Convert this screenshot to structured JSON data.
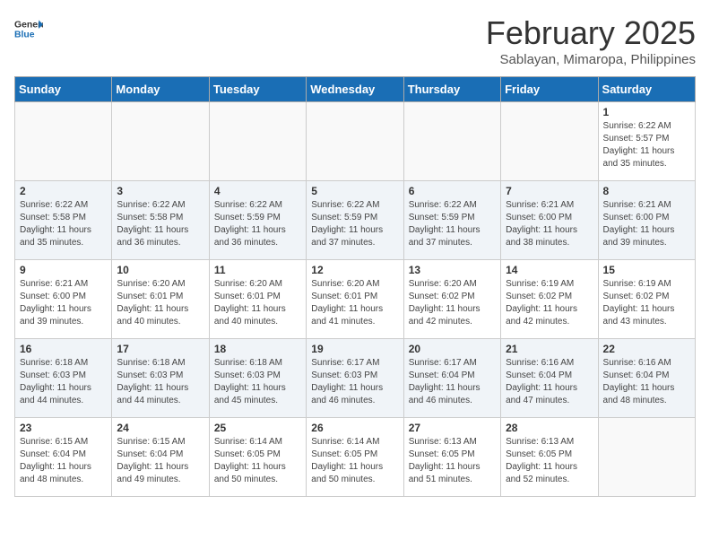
{
  "header": {
    "logo_line1": "General",
    "logo_line2": "Blue",
    "month": "February 2025",
    "location": "Sablayan, Mimaropa, Philippines"
  },
  "days_of_week": [
    "Sunday",
    "Monday",
    "Tuesday",
    "Wednesday",
    "Thursday",
    "Friday",
    "Saturday"
  ],
  "weeks": [
    [
      {
        "day": "",
        "info": ""
      },
      {
        "day": "",
        "info": ""
      },
      {
        "day": "",
        "info": ""
      },
      {
        "day": "",
        "info": ""
      },
      {
        "day": "",
        "info": ""
      },
      {
        "day": "",
        "info": ""
      },
      {
        "day": "1",
        "info": "Sunrise: 6:22 AM\nSunset: 5:57 PM\nDaylight: 11 hours\nand 35 minutes."
      }
    ],
    [
      {
        "day": "2",
        "info": "Sunrise: 6:22 AM\nSunset: 5:58 PM\nDaylight: 11 hours\nand 35 minutes."
      },
      {
        "day": "3",
        "info": "Sunrise: 6:22 AM\nSunset: 5:58 PM\nDaylight: 11 hours\nand 36 minutes."
      },
      {
        "day": "4",
        "info": "Sunrise: 6:22 AM\nSunset: 5:59 PM\nDaylight: 11 hours\nand 36 minutes."
      },
      {
        "day": "5",
        "info": "Sunrise: 6:22 AM\nSunset: 5:59 PM\nDaylight: 11 hours\nand 37 minutes."
      },
      {
        "day": "6",
        "info": "Sunrise: 6:22 AM\nSunset: 5:59 PM\nDaylight: 11 hours\nand 37 minutes."
      },
      {
        "day": "7",
        "info": "Sunrise: 6:21 AM\nSunset: 6:00 PM\nDaylight: 11 hours\nand 38 minutes."
      },
      {
        "day": "8",
        "info": "Sunrise: 6:21 AM\nSunset: 6:00 PM\nDaylight: 11 hours\nand 39 minutes."
      }
    ],
    [
      {
        "day": "9",
        "info": "Sunrise: 6:21 AM\nSunset: 6:00 PM\nDaylight: 11 hours\nand 39 minutes."
      },
      {
        "day": "10",
        "info": "Sunrise: 6:20 AM\nSunset: 6:01 PM\nDaylight: 11 hours\nand 40 minutes."
      },
      {
        "day": "11",
        "info": "Sunrise: 6:20 AM\nSunset: 6:01 PM\nDaylight: 11 hours\nand 40 minutes."
      },
      {
        "day": "12",
        "info": "Sunrise: 6:20 AM\nSunset: 6:01 PM\nDaylight: 11 hours\nand 41 minutes."
      },
      {
        "day": "13",
        "info": "Sunrise: 6:20 AM\nSunset: 6:02 PM\nDaylight: 11 hours\nand 42 minutes."
      },
      {
        "day": "14",
        "info": "Sunrise: 6:19 AM\nSunset: 6:02 PM\nDaylight: 11 hours\nand 42 minutes."
      },
      {
        "day": "15",
        "info": "Sunrise: 6:19 AM\nSunset: 6:02 PM\nDaylight: 11 hours\nand 43 minutes."
      }
    ],
    [
      {
        "day": "16",
        "info": "Sunrise: 6:18 AM\nSunset: 6:03 PM\nDaylight: 11 hours\nand 44 minutes."
      },
      {
        "day": "17",
        "info": "Sunrise: 6:18 AM\nSunset: 6:03 PM\nDaylight: 11 hours\nand 44 minutes."
      },
      {
        "day": "18",
        "info": "Sunrise: 6:18 AM\nSunset: 6:03 PM\nDaylight: 11 hours\nand 45 minutes."
      },
      {
        "day": "19",
        "info": "Sunrise: 6:17 AM\nSunset: 6:03 PM\nDaylight: 11 hours\nand 46 minutes."
      },
      {
        "day": "20",
        "info": "Sunrise: 6:17 AM\nSunset: 6:04 PM\nDaylight: 11 hours\nand 46 minutes."
      },
      {
        "day": "21",
        "info": "Sunrise: 6:16 AM\nSunset: 6:04 PM\nDaylight: 11 hours\nand 47 minutes."
      },
      {
        "day": "22",
        "info": "Sunrise: 6:16 AM\nSunset: 6:04 PM\nDaylight: 11 hours\nand 48 minutes."
      }
    ],
    [
      {
        "day": "23",
        "info": "Sunrise: 6:15 AM\nSunset: 6:04 PM\nDaylight: 11 hours\nand 48 minutes."
      },
      {
        "day": "24",
        "info": "Sunrise: 6:15 AM\nSunset: 6:04 PM\nDaylight: 11 hours\nand 49 minutes."
      },
      {
        "day": "25",
        "info": "Sunrise: 6:14 AM\nSunset: 6:05 PM\nDaylight: 11 hours\nand 50 minutes."
      },
      {
        "day": "26",
        "info": "Sunrise: 6:14 AM\nSunset: 6:05 PM\nDaylight: 11 hours\nand 50 minutes."
      },
      {
        "day": "27",
        "info": "Sunrise: 6:13 AM\nSunset: 6:05 PM\nDaylight: 11 hours\nand 51 minutes."
      },
      {
        "day": "28",
        "info": "Sunrise: 6:13 AM\nSunset: 6:05 PM\nDaylight: 11 hours\nand 52 minutes."
      },
      {
        "day": "",
        "info": ""
      }
    ]
  ]
}
